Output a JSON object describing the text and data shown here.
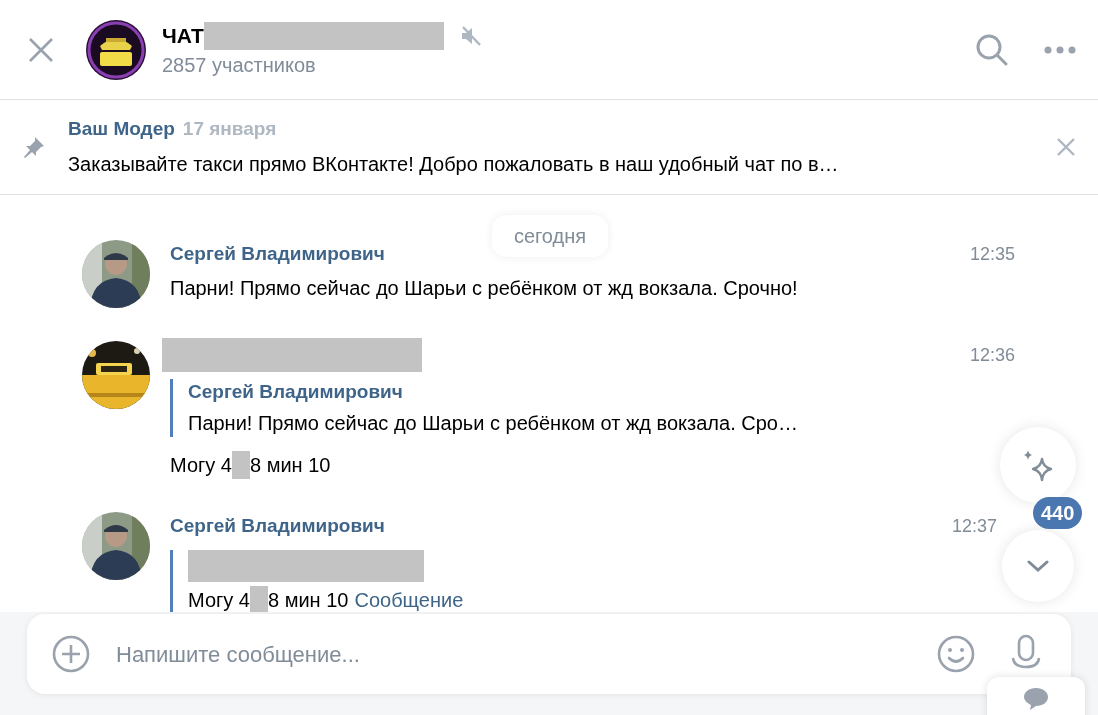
{
  "header": {
    "title": "ЧАТ",
    "subtitle": "2857 участников",
    "muted": true
  },
  "pinned": {
    "author": "Ваш Модер",
    "date": "17 января",
    "text": "Заказывайте такси прямо ВКонтакте! Добро пожаловать в наш удобный чат по в…"
  },
  "date_separator": "сегодня",
  "messages": [
    {
      "author": "Сергей Владимирович",
      "time": "12:35",
      "parts": [
        "Парни! Прямо сейчас до Шарьи с ребёнком от жд вокзала. Срочно!"
      ]
    },
    {
      "time": "12:36",
      "reply": {
        "author": "Сергей Владимирович",
        "parts": [
          "Парни! Прямо сейчас до Шарьи с ребёнком от жд вокзала. Сро…"
        ]
      },
      "parts": [
        "Могу 4",
        "8 мин 10"
      ]
    },
    {
      "author": "Сергей Владимирович",
      "time": "12:37",
      "reply": {
        "parts": [
          "Могу 4",
          "8 мин 10"
        ],
        "link": "Сообщение"
      }
    }
  ],
  "composer": {
    "placeholder": "Напишите сообщение..."
  },
  "unread_badge": "440"
}
